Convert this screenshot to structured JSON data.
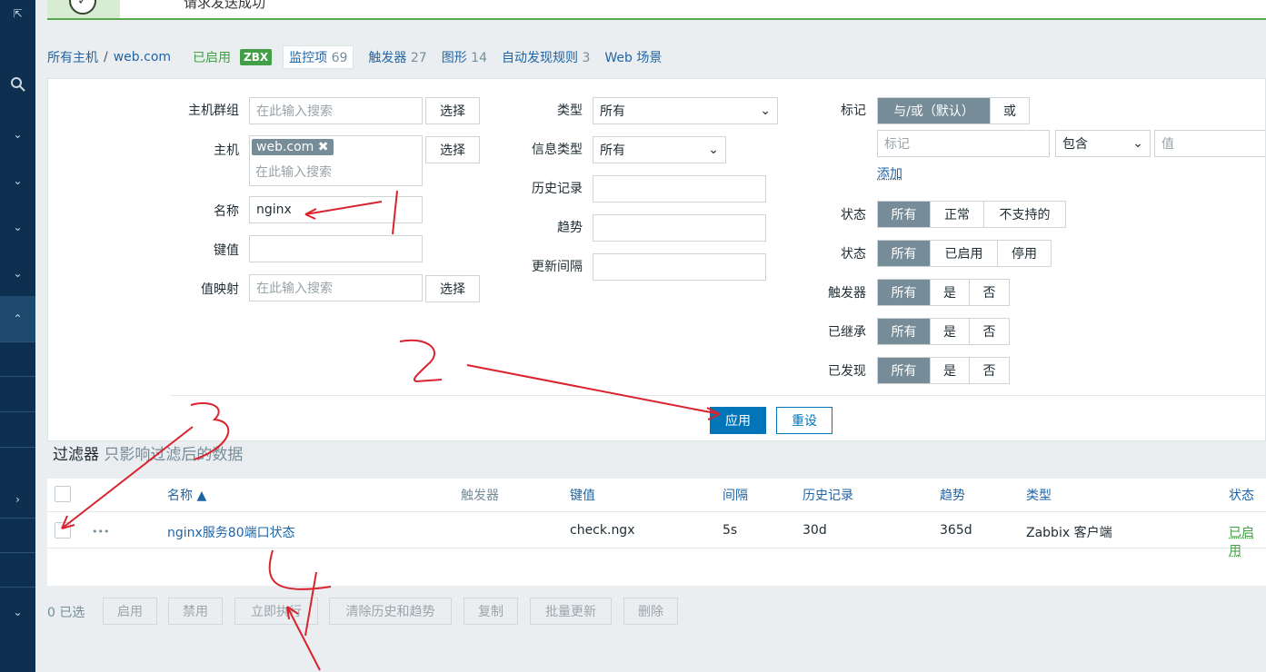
{
  "message": {
    "text": "请求发送成功"
  },
  "nav": {
    "all_hosts": "所有主机",
    "separator": "/",
    "host": "web.com",
    "enabled": "已启用",
    "zbx": "ZBX",
    "tabs": [
      {
        "label": "监控项",
        "count": "69"
      },
      {
        "label": "触发器",
        "count": "27"
      },
      {
        "label": "图形",
        "count": "14"
      },
      {
        "label": "自动发现规则",
        "count": "3"
      },
      {
        "label": "Web 场景",
        "count": ""
      }
    ]
  },
  "filter": {
    "host_group_label": "主机群组",
    "host_label": "主机",
    "name_label": "名称",
    "key_label": "键值",
    "valuemap_label": "值映射",
    "search_placeholder": "在此输入搜索",
    "select_button": "选择",
    "host_chip": "web.com",
    "name_value": "nginx",
    "type_label": "类型",
    "type_value": "所有",
    "info_type_label": "信息类型",
    "info_type_value": "所有",
    "history_label": "历史记录",
    "trends_label": "趋势",
    "interval_label": "更新间隔",
    "tags_label": "标记",
    "tags_mode": [
      "与/或（默认）",
      "或"
    ],
    "tag_placeholder": "标记",
    "tag_operator": "包含",
    "tag_value_placeholder": "值",
    "add_link": "添加",
    "state_label": "状态",
    "state_options": [
      "所有",
      "正常",
      "不支持的"
    ],
    "status_label": "状态",
    "status_options": [
      "所有",
      "已启用",
      "停用"
    ],
    "triggers_label": "触发器",
    "triggers_options": [
      "所有",
      "是",
      "否"
    ],
    "inherited_label": "已继承",
    "inherited_options": [
      "所有",
      "是",
      "否"
    ],
    "discovered_label": "已发现",
    "discovered_options": [
      "所有",
      "是",
      "否"
    ],
    "apply_button": "应用",
    "reset_button": "重设"
  },
  "filter_title": {
    "main": "过滤器",
    "sub": "只影响过滤后的数据"
  },
  "table": {
    "headers": {
      "name": "名称 ▲",
      "triggers": "触发器",
      "key": "键值",
      "interval": "间隔",
      "history": "历史记录",
      "trends": "趋势",
      "type": "类型",
      "status": "状态"
    },
    "rows": [
      {
        "more": "•••",
        "name": "nginx服务80端口状态",
        "triggers": "",
        "key": "check.ngx",
        "interval": "5s",
        "history": "30d",
        "trends": "365d",
        "type": "Zabbix 客户端",
        "status": "已启用"
      }
    ]
  },
  "actions": {
    "selected": "0 已选",
    "buttons": [
      "启用",
      "禁用",
      "立即执行",
      "清除历史和趋势",
      "复制",
      "批量更新",
      "删除"
    ]
  },
  "colors": {
    "link": "#1f65a6",
    "enabled": "#429e47",
    "primary": "#0275b8",
    "annotation": "#d9232e"
  }
}
